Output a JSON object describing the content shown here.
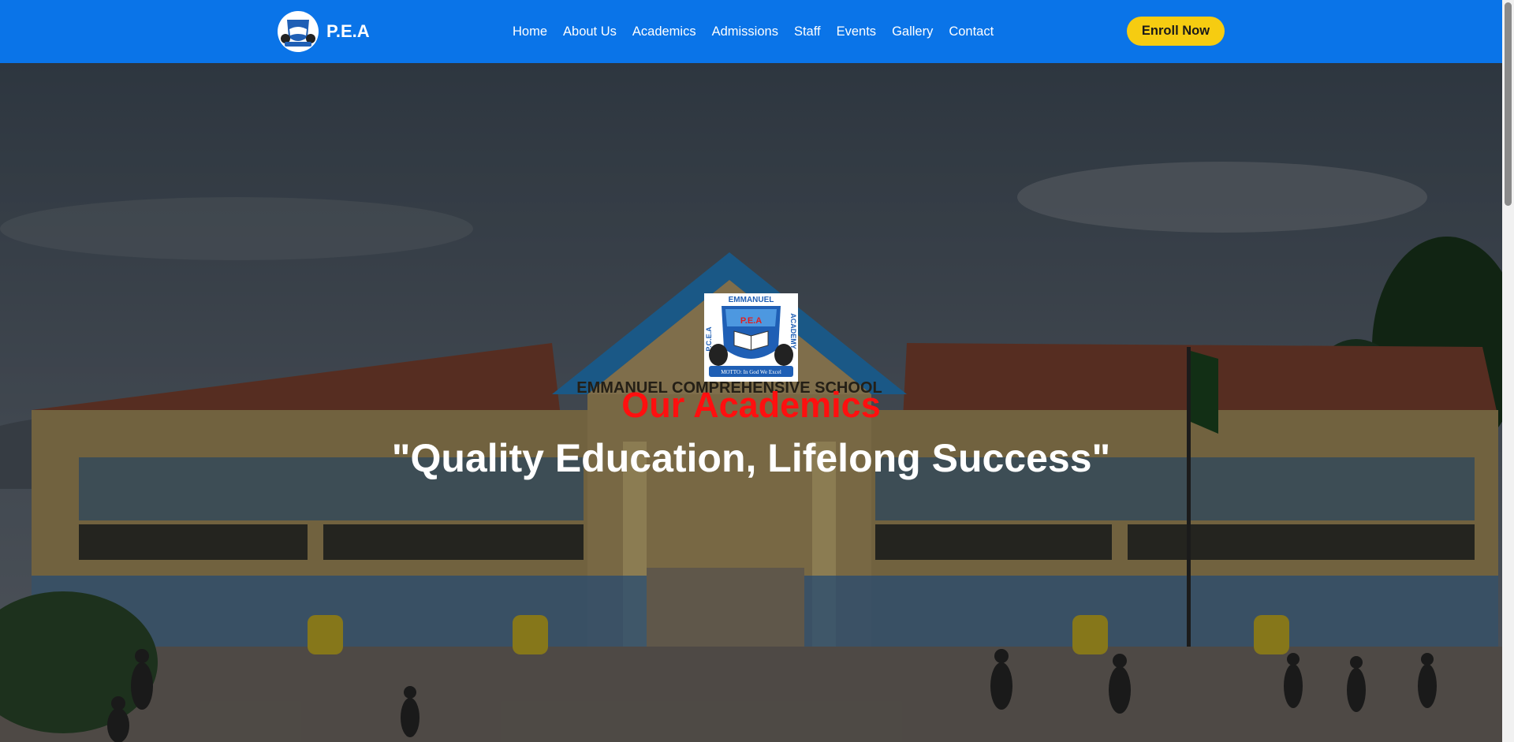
{
  "navbar": {
    "brand": "P.E.A",
    "links": [
      "Home",
      "About Us",
      "Academics",
      "Admissions",
      "Staff",
      "Events",
      "Gallery",
      "Contact"
    ],
    "cta": "Enroll Now"
  },
  "hero": {
    "title": "Our Academics",
    "tagline": "\"Quality Education, Lifelong Success\"",
    "building_sign": "EMMANUEL COMPREHENSIVE SCHOOL",
    "crest": {
      "top": "EMMANUEL",
      "left": "P.C.E.A",
      "right": "ACADEMY",
      "center": "P.E.A",
      "motto": "MOTTO: In God We Excel"
    }
  },
  "colors": {
    "nav_bg": "#0a74e8",
    "cta_bg": "#f6cc11",
    "title_red": "#ff0f0f"
  }
}
